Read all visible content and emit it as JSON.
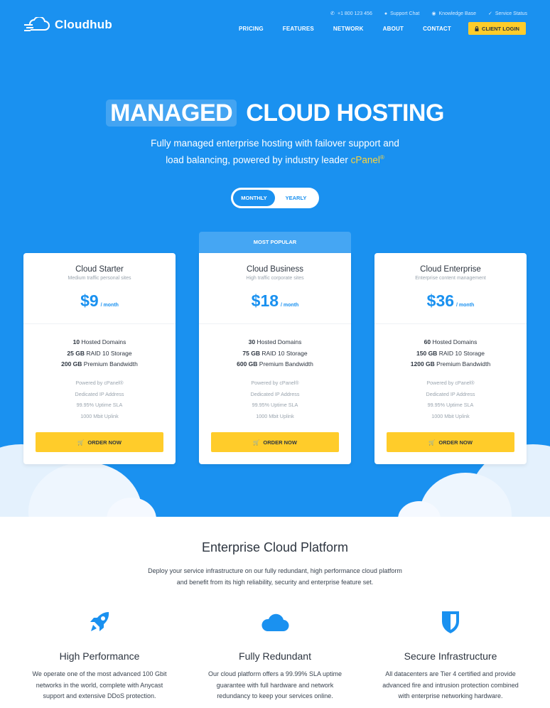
{
  "brand": {
    "name": "Cloudhub"
  },
  "toplinks": [
    {
      "icon": "phone-icon",
      "label": "+1 800 123 456"
    },
    {
      "icon": "chat-icon",
      "label": "Support Chat"
    },
    {
      "icon": "book-icon",
      "label": "Knowledge Base"
    },
    {
      "icon": "check-icon",
      "label": "Service Status"
    }
  ],
  "nav": {
    "items": [
      "PRICING",
      "FEATURES",
      "NETWORK",
      "ABOUT",
      "CONTACT"
    ],
    "client_login": "CLIENT LOGIN"
  },
  "hero": {
    "title_highlight": "MANAGED",
    "title_rest": "CLOUD HOSTING",
    "subtitle_line1": "Fully managed enterprise hosting with failover support and",
    "subtitle_line2": "load balancing, powered by industry leader",
    "subtitle_brand": "cPanel",
    "subtitle_reg": "®"
  },
  "billing_toggle": {
    "options": [
      "MONTHLY",
      "YEARLY"
    ],
    "selected": "MONTHLY"
  },
  "popular_label": "MOST POPULAR",
  "plans": [
    {
      "name": "Cloud Starter",
      "description": "Medium traffic personal sites",
      "price": "$9",
      "period": "/ month",
      "features": [
        {
          "value": "10",
          "label": "Hosted Domains"
        },
        {
          "value": "25 GB",
          "label": "RAID 10 Storage"
        },
        {
          "value": "200 GB",
          "label": "Premium Bandwidth"
        }
      ],
      "extras": [
        "Powered by cPanel®",
        "Dedicated IP Address",
        "99.95% Uptime SLA",
        "1000 Mbit Uplink"
      ],
      "cta": "ORDER NOW"
    },
    {
      "name": "Cloud Business",
      "description": "High traffic corporate sites",
      "price": "$18",
      "period": "/ month",
      "features": [
        {
          "value": "30",
          "label": "Hosted Domains"
        },
        {
          "value": "75 GB",
          "label": "RAID 10 Storage"
        },
        {
          "value": "600 GB",
          "label": "Premium Bandwidth"
        }
      ],
      "extras": [
        "Powered by cPanel®",
        "Dedicated IP Address",
        "99.95% Uptime SLA",
        "1000 Mbit Uplink"
      ],
      "cta": "ORDER NOW"
    },
    {
      "name": "Cloud Enterprise",
      "description": "Enterprise content management",
      "price": "$36",
      "period": "/ month",
      "features": [
        {
          "value": "60",
          "label": "Hosted Domains"
        },
        {
          "value": "150 GB",
          "label": "RAID 10 Storage"
        },
        {
          "value": "1200 GB",
          "label": "Premium Bandwidth"
        }
      ],
      "extras": [
        "Powered by cPanel®",
        "Dedicated IP Address",
        "99.95% Uptime SLA",
        "1000 Mbit Uplink"
      ],
      "cta": "ORDER NOW"
    }
  ],
  "platform": {
    "title": "Enterprise Cloud Platform",
    "desc_line1": "Deploy your service infrastructure on our fully redundant, high performance cloud platform",
    "desc_line2": "and benefit from its high reliability, security and enterprise feature set.",
    "features": [
      {
        "icon": "rocket-icon",
        "title": "High Performance",
        "lines": [
          "We operate one of the most advanced 100 Gbit",
          "networks in the world, complete with Anycast",
          "support and extensive DDoS protection."
        ]
      },
      {
        "icon": "cloud-icon",
        "title": "Fully Redundant",
        "lines": [
          "Our cloud platform offers a 99.99% SLA uptime",
          "guarantee with full hardware and network",
          "redundancy to keep your services online."
        ]
      },
      {
        "icon": "shield-icon",
        "title": "Secure Infrastructure",
        "lines": [
          "All datacenters are Tier 4 certified and provide",
          "advanced fire and intrusion protection combined",
          "with enterprise networking hardware."
        ]
      }
    ]
  },
  "colors": {
    "primary": "#1a91f0",
    "accent": "#ffcc2a",
    "popular_tab": "#45a6f3",
    "cloud": "#e4f1fd"
  }
}
